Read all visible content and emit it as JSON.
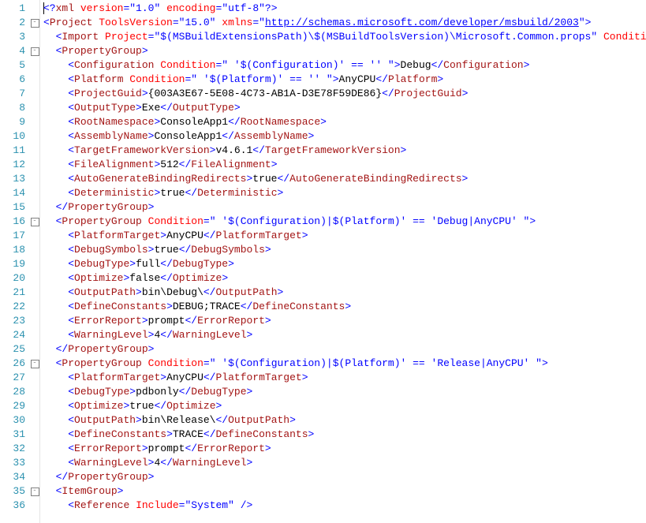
{
  "line_start": 1,
  "line_end": 36,
  "fold_markers": {
    "2": "-",
    "4": "-",
    "16": "-",
    "26": "-",
    "35": "-"
  },
  "code_lines": [
    {
      "n": 1,
      "indent": 0,
      "tokens": [
        [
          "cur",
          ""
        ],
        [
          "p",
          "<?"
        ],
        [
          "t",
          "xml"
        ],
        [
          "k",
          " "
        ],
        [
          "a",
          "version"
        ],
        [
          "p",
          "="
        ],
        [
          "s",
          "\"1.0\""
        ],
        [
          "k",
          " "
        ],
        [
          "a",
          "encoding"
        ],
        [
          "p",
          "="
        ],
        [
          "s",
          "\"utf-8\""
        ],
        [
          "p",
          "?>"
        ]
      ]
    },
    {
      "n": 2,
      "indent": 0,
      "tokens": [
        [
          "p",
          "<"
        ],
        [
          "t",
          "Project"
        ],
        [
          "k",
          " "
        ],
        [
          "a",
          "ToolsVersion"
        ],
        [
          "p",
          "="
        ],
        [
          "s",
          "\"15.0\""
        ],
        [
          "k",
          " "
        ],
        [
          "a",
          "xmlns"
        ],
        [
          "p",
          "="
        ],
        [
          "s",
          "\""
        ],
        [
          "lnk",
          "http://schemas.microsoft.com/developer/msbuild/2003"
        ],
        [
          "s",
          "\""
        ],
        [
          "p",
          ">"
        ]
      ]
    },
    {
      "n": 3,
      "indent": 1,
      "tokens": [
        [
          "p",
          "<"
        ],
        [
          "t",
          "Import"
        ],
        [
          "k",
          " "
        ],
        [
          "a",
          "Project"
        ],
        [
          "p",
          "="
        ],
        [
          "s",
          "\"$(MSBuildExtensionsPath)\\$(MSBuildToolsVersion)\\Microsoft.Common.props\""
        ],
        [
          "k",
          " "
        ],
        [
          "a",
          "Conditi"
        ]
      ]
    },
    {
      "n": 4,
      "indent": 1,
      "tokens": [
        [
          "p",
          "<"
        ],
        [
          "t",
          "PropertyGroup"
        ],
        [
          "p",
          ">"
        ]
      ]
    },
    {
      "n": 5,
      "indent": 2,
      "tokens": [
        [
          "p",
          "<"
        ],
        [
          "t",
          "Configuration"
        ],
        [
          "k",
          " "
        ],
        [
          "a",
          "Condition"
        ],
        [
          "p",
          "="
        ],
        [
          "s",
          "\" '$(Configuration)' == '' \""
        ],
        [
          "p",
          ">"
        ],
        [
          "k",
          "Debug"
        ],
        [
          "p",
          "</"
        ],
        [
          "t",
          "Configuration"
        ],
        [
          "p",
          ">"
        ]
      ]
    },
    {
      "n": 6,
      "indent": 2,
      "tokens": [
        [
          "p",
          "<"
        ],
        [
          "t",
          "Platform"
        ],
        [
          "k",
          " "
        ],
        [
          "a",
          "Condition"
        ],
        [
          "p",
          "="
        ],
        [
          "s",
          "\" '$(Platform)' == '' \""
        ],
        [
          "p",
          ">"
        ],
        [
          "k",
          "AnyCPU"
        ],
        [
          "p",
          "</"
        ],
        [
          "t",
          "Platform"
        ],
        [
          "p",
          ">"
        ]
      ]
    },
    {
      "n": 7,
      "indent": 2,
      "tokens": [
        [
          "p",
          "<"
        ],
        [
          "t",
          "ProjectGuid"
        ],
        [
          "p",
          ">"
        ],
        [
          "k",
          "{003A3E67-5E08-4C73-AB1A-D3E78F59DE86}"
        ],
        [
          "p",
          "</"
        ],
        [
          "t",
          "ProjectGuid"
        ],
        [
          "p",
          ">"
        ]
      ]
    },
    {
      "n": 8,
      "indent": 2,
      "tokens": [
        [
          "p",
          "<"
        ],
        [
          "t",
          "OutputType"
        ],
        [
          "p",
          ">"
        ],
        [
          "k",
          "Exe"
        ],
        [
          "p",
          "</"
        ],
        [
          "t",
          "OutputType"
        ],
        [
          "p",
          ">"
        ]
      ]
    },
    {
      "n": 9,
      "indent": 2,
      "tokens": [
        [
          "p",
          "<"
        ],
        [
          "t",
          "RootNamespace"
        ],
        [
          "p",
          ">"
        ],
        [
          "k",
          "ConsoleApp1"
        ],
        [
          "p",
          "</"
        ],
        [
          "t",
          "RootNamespace"
        ],
        [
          "p",
          ">"
        ]
      ]
    },
    {
      "n": 10,
      "indent": 2,
      "tokens": [
        [
          "p",
          "<"
        ],
        [
          "t",
          "AssemblyName"
        ],
        [
          "p",
          ">"
        ],
        [
          "k",
          "ConsoleApp1"
        ],
        [
          "p",
          "</"
        ],
        [
          "t",
          "AssemblyName"
        ],
        [
          "p",
          ">"
        ]
      ]
    },
    {
      "n": 11,
      "indent": 2,
      "tokens": [
        [
          "p",
          "<"
        ],
        [
          "t",
          "TargetFrameworkVersion"
        ],
        [
          "p",
          ">"
        ],
        [
          "k",
          "v4.6.1"
        ],
        [
          "p",
          "</"
        ],
        [
          "t",
          "TargetFrameworkVersion"
        ],
        [
          "p",
          ">"
        ]
      ]
    },
    {
      "n": 12,
      "indent": 2,
      "tokens": [
        [
          "p",
          "<"
        ],
        [
          "t",
          "FileAlignment"
        ],
        [
          "p",
          ">"
        ],
        [
          "k",
          "512"
        ],
        [
          "p",
          "</"
        ],
        [
          "t",
          "FileAlignment"
        ],
        [
          "p",
          ">"
        ]
      ]
    },
    {
      "n": 13,
      "indent": 2,
      "tokens": [
        [
          "p",
          "<"
        ],
        [
          "t",
          "AutoGenerateBindingRedirects"
        ],
        [
          "p",
          ">"
        ],
        [
          "k",
          "true"
        ],
        [
          "p",
          "</"
        ],
        [
          "t",
          "AutoGenerateBindingRedirects"
        ],
        [
          "p",
          ">"
        ]
      ]
    },
    {
      "n": 14,
      "indent": 2,
      "tokens": [
        [
          "p",
          "<"
        ],
        [
          "t",
          "Deterministic"
        ],
        [
          "p",
          ">"
        ],
        [
          "k",
          "true"
        ],
        [
          "p",
          "</"
        ],
        [
          "t",
          "Deterministic"
        ],
        [
          "p",
          ">"
        ]
      ]
    },
    {
      "n": 15,
      "indent": 1,
      "tokens": [
        [
          "p",
          "</"
        ],
        [
          "t",
          "PropertyGroup"
        ],
        [
          "p",
          ">"
        ]
      ]
    },
    {
      "n": 16,
      "indent": 1,
      "tokens": [
        [
          "p",
          "<"
        ],
        [
          "t",
          "PropertyGroup"
        ],
        [
          "k",
          " "
        ],
        [
          "a",
          "Condition"
        ],
        [
          "p",
          "="
        ],
        [
          "s",
          "\" '$(Configuration)|$(Platform)' == 'Debug|AnyCPU' \""
        ],
        [
          "p",
          ">"
        ]
      ]
    },
    {
      "n": 17,
      "indent": 2,
      "tokens": [
        [
          "p",
          "<"
        ],
        [
          "t",
          "PlatformTarget"
        ],
        [
          "p",
          ">"
        ],
        [
          "k",
          "AnyCPU"
        ],
        [
          "p",
          "</"
        ],
        [
          "t",
          "PlatformTarget"
        ],
        [
          "p",
          ">"
        ]
      ]
    },
    {
      "n": 18,
      "indent": 2,
      "tokens": [
        [
          "p",
          "<"
        ],
        [
          "t",
          "DebugSymbols"
        ],
        [
          "p",
          ">"
        ],
        [
          "k",
          "true"
        ],
        [
          "p",
          "</"
        ],
        [
          "t",
          "DebugSymbols"
        ],
        [
          "p",
          ">"
        ]
      ]
    },
    {
      "n": 19,
      "indent": 2,
      "tokens": [
        [
          "p",
          "<"
        ],
        [
          "t",
          "DebugType"
        ],
        [
          "p",
          ">"
        ],
        [
          "k",
          "full"
        ],
        [
          "p",
          "</"
        ],
        [
          "t",
          "DebugType"
        ],
        [
          "p",
          ">"
        ]
      ]
    },
    {
      "n": 20,
      "indent": 2,
      "tokens": [
        [
          "p",
          "<"
        ],
        [
          "t",
          "Optimize"
        ],
        [
          "p",
          ">"
        ],
        [
          "k",
          "false"
        ],
        [
          "p",
          "</"
        ],
        [
          "t",
          "Optimize"
        ],
        [
          "p",
          ">"
        ]
      ]
    },
    {
      "n": 21,
      "indent": 2,
      "tokens": [
        [
          "p",
          "<"
        ],
        [
          "t",
          "OutputPath"
        ],
        [
          "p",
          ">"
        ],
        [
          "k",
          "bin\\Debug\\"
        ],
        [
          "p",
          "</"
        ],
        [
          "t",
          "OutputPath"
        ],
        [
          "p",
          ">"
        ]
      ]
    },
    {
      "n": 22,
      "indent": 2,
      "tokens": [
        [
          "p",
          "<"
        ],
        [
          "t",
          "DefineConstants"
        ],
        [
          "p",
          ">"
        ],
        [
          "k",
          "DEBUG;TRACE"
        ],
        [
          "p",
          "</"
        ],
        [
          "t",
          "DefineConstants"
        ],
        [
          "p",
          ">"
        ]
      ]
    },
    {
      "n": 23,
      "indent": 2,
      "tokens": [
        [
          "p",
          "<"
        ],
        [
          "t",
          "ErrorReport"
        ],
        [
          "p",
          ">"
        ],
        [
          "k",
          "prompt"
        ],
        [
          "p",
          "</"
        ],
        [
          "t",
          "ErrorReport"
        ],
        [
          "p",
          ">"
        ]
      ]
    },
    {
      "n": 24,
      "indent": 2,
      "tokens": [
        [
          "p",
          "<"
        ],
        [
          "t",
          "WarningLevel"
        ],
        [
          "p",
          ">"
        ],
        [
          "k",
          "4"
        ],
        [
          "p",
          "</"
        ],
        [
          "t",
          "WarningLevel"
        ],
        [
          "p",
          ">"
        ]
      ]
    },
    {
      "n": 25,
      "indent": 1,
      "tokens": [
        [
          "p",
          "</"
        ],
        [
          "t",
          "PropertyGroup"
        ],
        [
          "p",
          ">"
        ]
      ]
    },
    {
      "n": 26,
      "indent": 1,
      "tokens": [
        [
          "p",
          "<"
        ],
        [
          "t",
          "PropertyGroup"
        ],
        [
          "k",
          " "
        ],
        [
          "a",
          "Condition"
        ],
        [
          "p",
          "="
        ],
        [
          "s",
          "\" '$(Configuration)|$(Platform)' == 'Release|AnyCPU' \""
        ],
        [
          "p",
          ">"
        ]
      ]
    },
    {
      "n": 27,
      "indent": 2,
      "tokens": [
        [
          "p",
          "<"
        ],
        [
          "t",
          "PlatformTarget"
        ],
        [
          "p",
          ">"
        ],
        [
          "k",
          "AnyCPU"
        ],
        [
          "p",
          "</"
        ],
        [
          "t",
          "PlatformTarget"
        ],
        [
          "p",
          ">"
        ]
      ]
    },
    {
      "n": 28,
      "indent": 2,
      "tokens": [
        [
          "p",
          "<"
        ],
        [
          "t",
          "DebugType"
        ],
        [
          "p",
          ">"
        ],
        [
          "k",
          "pdbonly"
        ],
        [
          "p",
          "</"
        ],
        [
          "t",
          "DebugType"
        ],
        [
          "p",
          ">"
        ]
      ]
    },
    {
      "n": 29,
      "indent": 2,
      "tokens": [
        [
          "p",
          "<"
        ],
        [
          "t",
          "Optimize"
        ],
        [
          "p",
          ">"
        ],
        [
          "k",
          "true"
        ],
        [
          "p",
          "</"
        ],
        [
          "t",
          "Optimize"
        ],
        [
          "p",
          ">"
        ]
      ]
    },
    {
      "n": 30,
      "indent": 2,
      "tokens": [
        [
          "p",
          "<"
        ],
        [
          "t",
          "OutputPath"
        ],
        [
          "p",
          ">"
        ],
        [
          "k",
          "bin\\Release\\"
        ],
        [
          "p",
          "</"
        ],
        [
          "t",
          "OutputPath"
        ],
        [
          "p",
          ">"
        ]
      ]
    },
    {
      "n": 31,
      "indent": 2,
      "tokens": [
        [
          "p",
          "<"
        ],
        [
          "t",
          "DefineConstants"
        ],
        [
          "p",
          ">"
        ],
        [
          "k",
          "TRACE"
        ],
        [
          "p",
          "</"
        ],
        [
          "t",
          "DefineConstants"
        ],
        [
          "p",
          ">"
        ]
      ]
    },
    {
      "n": 32,
      "indent": 2,
      "tokens": [
        [
          "p",
          "<"
        ],
        [
          "t",
          "ErrorReport"
        ],
        [
          "p",
          ">"
        ],
        [
          "k",
          "prompt"
        ],
        [
          "p",
          "</"
        ],
        [
          "t",
          "ErrorReport"
        ],
        [
          "p",
          ">"
        ]
      ]
    },
    {
      "n": 33,
      "indent": 2,
      "tokens": [
        [
          "p",
          "<"
        ],
        [
          "t",
          "WarningLevel"
        ],
        [
          "p",
          ">"
        ],
        [
          "k",
          "4"
        ],
        [
          "p",
          "</"
        ],
        [
          "t",
          "WarningLevel"
        ],
        [
          "p",
          ">"
        ]
      ]
    },
    {
      "n": 34,
      "indent": 1,
      "tokens": [
        [
          "p",
          "</"
        ],
        [
          "t",
          "PropertyGroup"
        ],
        [
          "p",
          ">"
        ]
      ]
    },
    {
      "n": 35,
      "indent": 1,
      "tokens": [
        [
          "p",
          "<"
        ],
        [
          "t",
          "ItemGroup"
        ],
        [
          "p",
          ">"
        ]
      ]
    },
    {
      "n": 36,
      "indent": 2,
      "tokens": [
        [
          "p",
          "<"
        ],
        [
          "t",
          "Reference"
        ],
        [
          "k",
          " "
        ],
        [
          "a",
          "Include"
        ],
        [
          "p",
          "="
        ],
        [
          "s",
          "\"System\""
        ],
        [
          "k",
          " "
        ],
        [
          "p",
          "/>"
        ]
      ]
    }
  ]
}
